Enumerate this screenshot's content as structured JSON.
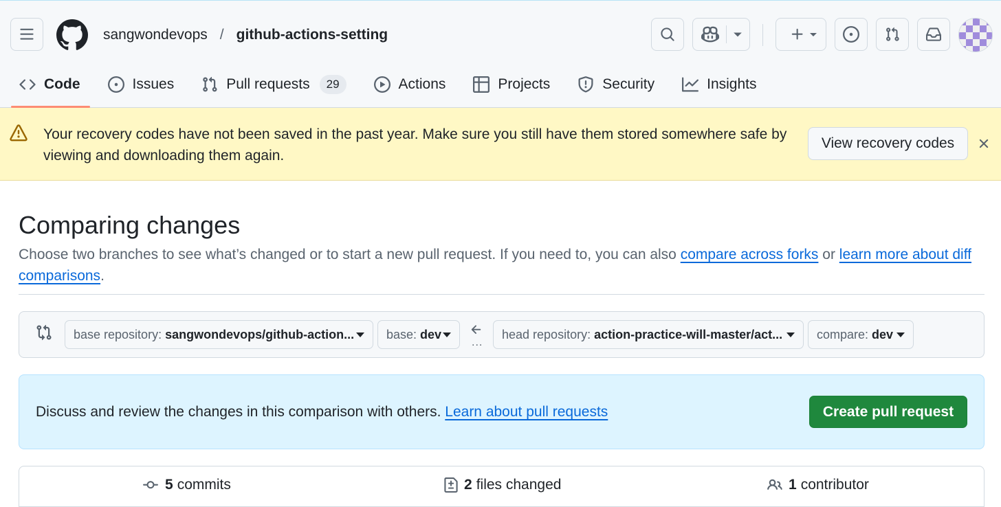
{
  "header": {
    "owner": "sangwondevops",
    "separator": "/",
    "repo": "github-actions-setting"
  },
  "nav": {
    "items": [
      {
        "label": "Code",
        "icon": "code-icon",
        "active": true
      },
      {
        "label": "Issues",
        "icon": "issue-opened-icon"
      },
      {
        "label": "Pull requests",
        "icon": "git-pull-request-icon",
        "count": "29"
      },
      {
        "label": "Actions",
        "icon": "play-icon"
      },
      {
        "label": "Projects",
        "icon": "table-icon"
      },
      {
        "label": "Security",
        "icon": "shield-icon"
      },
      {
        "label": "Insights",
        "icon": "graph-icon"
      }
    ]
  },
  "banner": {
    "text": "Your recovery codes have not been saved in the past year. Make sure you still have them stored somewhere safe by viewing and downloading them again.",
    "button": "View recovery codes"
  },
  "main": {
    "title": "Comparing changes",
    "desc_prefix": "Choose two branches to see what’s changed or to start a new pull request. If you need to, you can also ",
    "link_forks": "compare across forks",
    "desc_mid": " or ",
    "link_diff": "learn more about diff comparisons",
    "desc_suffix": "."
  },
  "compare": {
    "base_repo_label": "base repository: ",
    "base_repo_value": "sangwondevops/github-action...",
    "base_label": "base: ",
    "base_value": "dev",
    "head_repo_label": "head repository: ",
    "head_repo_value": "action-practice-will-master/act...",
    "compare_label": "compare: ",
    "compare_value": "dev",
    "dots": "..."
  },
  "info": {
    "text": "Discuss and review the changes in this comparison with others. ",
    "link": "Learn about pull requests",
    "button": "Create pull request"
  },
  "stats": {
    "commits_count": "5",
    "commits_label": "commits",
    "files_count": "2",
    "files_label": "files changed",
    "contributors_count": "1",
    "contributors_label": "contributor"
  },
  "colors": {
    "accent_underline": "#fd8c73",
    "link": "#0969da",
    "primary_button": "#1f883d",
    "warning_bg": "#fff8c5",
    "info_bg": "#ddf4ff"
  }
}
